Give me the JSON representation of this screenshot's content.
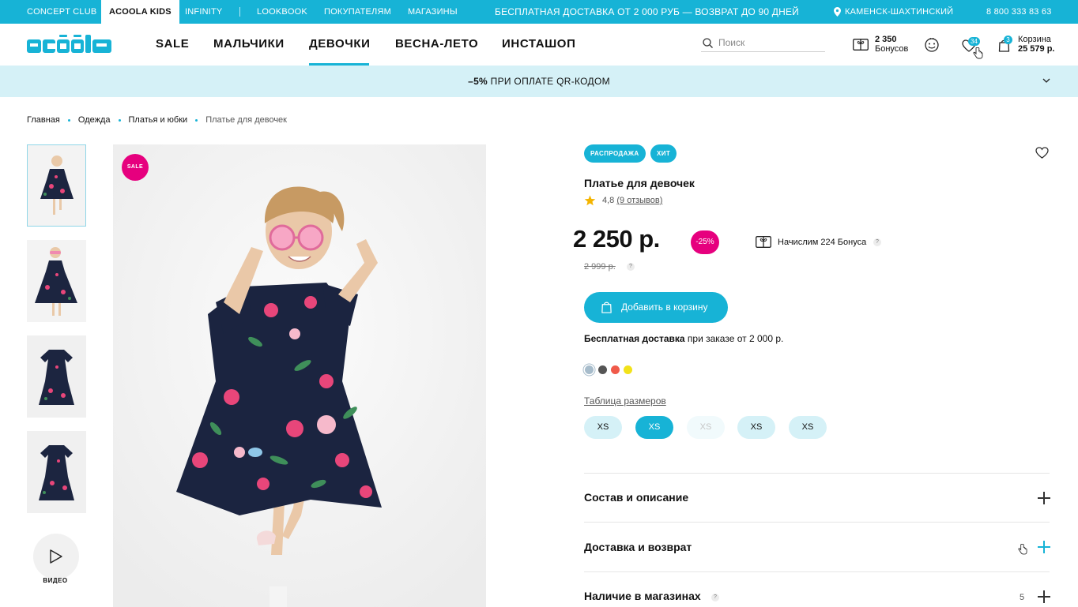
{
  "topbar": {
    "concept_club": "CONCEPT CLUB",
    "acoola_kids": "ACOOLA KIDS",
    "infinity": "INFINITY",
    "lookbook": "LOOKBOOK",
    "customers": "ПОКУПАТЕЛЯМ",
    "stores": "МАГАЗИНЫ",
    "promo": "БЕСПЛАТНАЯ ДОСТАВКА ОТ 2 000 РУБ — ВОЗВРАТ ДО 90 ДНЕЙ",
    "city": "КАМЕНСК-ШАХТИНСКИЙ",
    "phone": "8 800 333 83 63"
  },
  "header": {
    "nav": [
      "SALE",
      "МАЛЬЧИКИ",
      "ДЕВОЧКИ",
      "ВЕСНА-ЛЕТО",
      "ИНСТАШОП"
    ],
    "active_nav": "ДЕВОЧКИ",
    "search_placeholder": "Поиск",
    "bonus_amount": "2 350",
    "bonus_label": "Бонусов",
    "favorites_count": "34",
    "cart_count": "3",
    "cart_label": "Корзина",
    "cart_total": "25 579 р."
  },
  "promo_banner": {
    "bold": "–5%",
    "text": " ПРИ ОПЛАТЕ QR-КОДОМ"
  },
  "breadcrumbs": [
    "Главная",
    "Одежда",
    "Платья и юбки",
    "Платье для девочек"
  ],
  "gallery": {
    "sale_badge": "SALE",
    "video_label": "ВИДЕО",
    "thumbnail_count": 4
  },
  "product": {
    "tags": [
      "РАСПРОДАЖА",
      "ХИТ"
    ],
    "title": "Платье для девочек",
    "rating": "4,8",
    "reviews": "(9 отзывов)",
    "price": "2 250 р.",
    "discount": "-25%",
    "bonus": "Начислим 224 Бонуса",
    "old_price": "2 999 р.",
    "add_to_cart": "Добавить в корзину",
    "delivery_bold": "Бесплатная доставка",
    "delivery_rest": " при заказе от 2 000 р.",
    "colors": [
      "#a7bccb",
      "#555555",
      "#f05a4a",
      "#f2e21a"
    ],
    "size_table": "Таблица размеров",
    "sizes": [
      {
        "label": "XS",
        "state": "available"
      },
      {
        "label": "XS",
        "state": "selected"
      },
      {
        "label": "XS",
        "state": "unavailable"
      },
      {
        "label": "XS",
        "state": "available"
      },
      {
        "label": "XS",
        "state": "available"
      }
    ]
  },
  "accordion": [
    {
      "title": "Состав и описание"
    },
    {
      "title": "Доставка и возврат"
    },
    {
      "title": "Наличие в магазинах",
      "count": "5"
    }
  ],
  "colors": {
    "accent": "#17b3d6",
    "accent_light": "#d5f1f7",
    "sale": "#e6007e"
  }
}
